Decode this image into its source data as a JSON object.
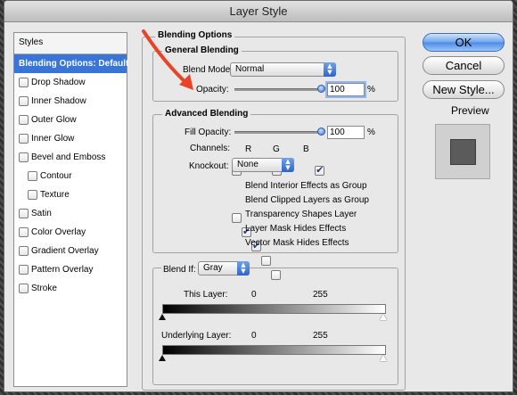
{
  "window": {
    "title": "Layer Style"
  },
  "styles_panel": {
    "header": "Styles",
    "items": [
      {
        "label": "Blending Options: Default",
        "selected": true,
        "checkbox": false,
        "sub": false
      },
      {
        "label": "Drop Shadow",
        "checkbox": true,
        "sub": false
      },
      {
        "label": "Inner Shadow",
        "checkbox": true,
        "sub": false
      },
      {
        "label": "Outer Glow",
        "checkbox": true,
        "sub": false
      },
      {
        "label": "Inner Glow",
        "checkbox": true,
        "sub": false
      },
      {
        "label": "Bevel and Emboss",
        "checkbox": true,
        "sub": false
      },
      {
        "label": "Contour",
        "checkbox": true,
        "sub": true
      },
      {
        "label": "Texture",
        "checkbox": true,
        "sub": true
      },
      {
        "label": "Satin",
        "checkbox": true,
        "sub": false
      },
      {
        "label": "Color Overlay",
        "checkbox": true,
        "sub": false
      },
      {
        "label": "Gradient Overlay",
        "checkbox": true,
        "sub": false
      },
      {
        "label": "Pattern Overlay",
        "checkbox": true,
        "sub": false
      },
      {
        "label": "Stroke",
        "checkbox": true,
        "sub": false
      }
    ]
  },
  "blending_options": {
    "title": "Blending Options",
    "general": {
      "title": "General Blending",
      "blend_mode_label": "Blend Mode:",
      "blend_mode_value": "Normal",
      "opacity_label": "Opacity:",
      "opacity_value": "100",
      "opacity_unit": "%",
      "opacity_level": 1.0
    },
    "advanced": {
      "title": "Advanced Blending",
      "fill_opacity_label": "Fill Opacity:",
      "fill_opacity_value": "100",
      "fill_opacity_unit": "%",
      "fill_opacity_level": 1.0,
      "channels_label": "Channels:",
      "channel_r": "R",
      "channel_g": "G",
      "channel_b": "B",
      "knockout_label": "Knockout:",
      "knockout_value": "None",
      "options": [
        {
          "label": "Blend Interior Effects as Group",
          "checked": false
        },
        {
          "label": "Blend Clipped Layers as Group",
          "checked": true
        },
        {
          "label": "Transparency Shapes Layer",
          "checked": true
        },
        {
          "label": "Layer Mask Hides Effects",
          "checked": false
        },
        {
          "label": "Vector Mask Hides Effects",
          "checked": false
        }
      ]
    },
    "blend_if": {
      "label": "Blend If:",
      "value": "Gray",
      "this_layer_label": "This Layer:",
      "this_layer_min": "0",
      "this_layer_max": "255",
      "underlying_label": "Underlying Layer:",
      "underlying_min": "0",
      "underlying_max": "255"
    }
  },
  "buttons": {
    "ok": "OK",
    "cancel": "Cancel",
    "new_style": "New Style..."
  },
  "preview": {
    "label": "Preview",
    "checked": true
  },
  "colors": {
    "selection": "#3875d7",
    "annotation_arrow": "#e8442a"
  }
}
